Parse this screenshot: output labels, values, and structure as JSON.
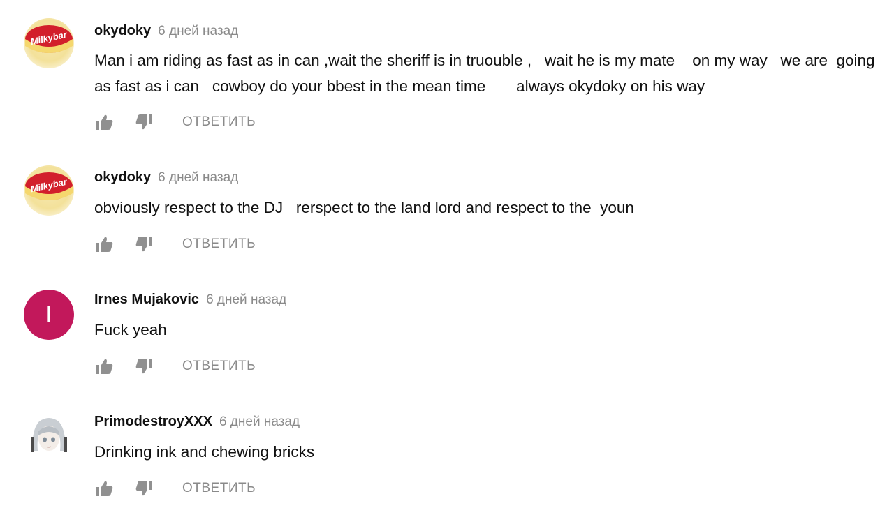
{
  "comments": [
    {
      "author": "okydoky",
      "time": "6 дней назад",
      "text": "Man i am riding as fast as in can ,wait the sheriff is in truouble ,   wait he is my mate    on my way   we are  going as fast as i can   cowboy do your bbest in the mean time       always okydoky on his way",
      "reply_label": "ОТВЕТИТЬ",
      "avatar_icon": "milkybar-avatar",
      "avatar_logo": "Milkybar"
    },
    {
      "author": "okydoky",
      "time": "6 дней назад",
      "text": "obviously respect to the DJ   rerspect to the land lord and respect to the  youn",
      "reply_label": "ОТВЕТИТЬ",
      "avatar_icon": "milkybar-avatar",
      "avatar_logo": "Milkybar"
    },
    {
      "author": "Irnes Mujakovic",
      "time": "6 дней назад",
      "text": "Fuck yeah",
      "reply_label": "ОТВЕТИТЬ",
      "avatar_letter": "I",
      "avatar_color": "#c2185b"
    },
    {
      "author": "PrimodestroyXXX",
      "time": "6 дней назад",
      "text": "Drinking ink and chewing bricks",
      "reply_label": "ОТВЕТИТЬ",
      "avatar_icon": "anime-girl-avatar"
    }
  ],
  "icons": {
    "like": "thumbs-up-icon",
    "dislike": "thumbs-down-icon"
  },
  "colors": {
    "meta_gray": "#8a8a8a",
    "icon_gray": "#909090"
  }
}
